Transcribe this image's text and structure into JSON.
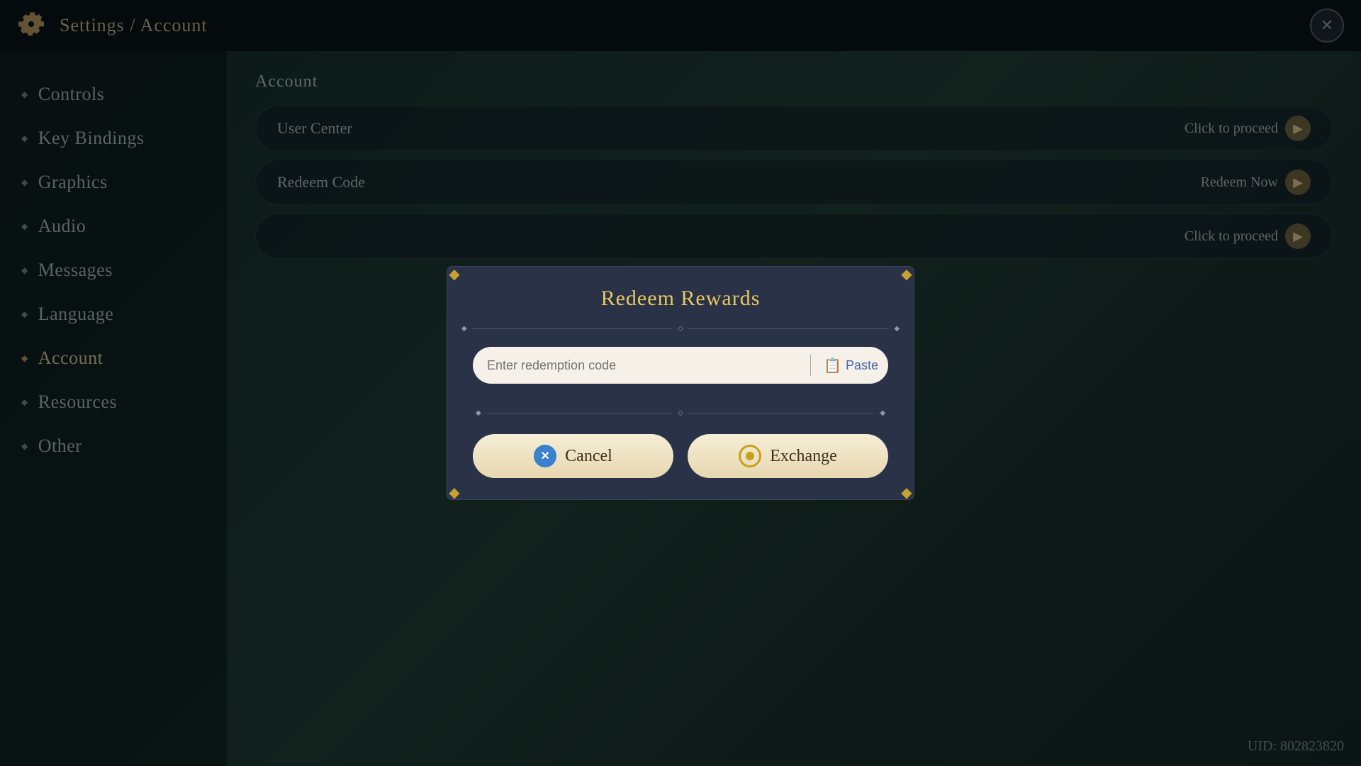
{
  "topbar": {
    "title": "Settings / Account",
    "close_label": "✕"
  },
  "sidebar": {
    "items": [
      {
        "id": "controls",
        "label": "Controls",
        "active": false
      },
      {
        "id": "key-bindings",
        "label": "Key Bindings",
        "active": false
      },
      {
        "id": "graphics",
        "label": "Graphics",
        "active": false
      },
      {
        "id": "audio",
        "label": "Audio",
        "active": false
      },
      {
        "id": "messages",
        "label": "Messages",
        "active": false
      },
      {
        "id": "language",
        "label": "Language",
        "active": false
      },
      {
        "id": "account",
        "label": "Account",
        "active": true
      },
      {
        "id": "resources",
        "label": "Resources",
        "active": false
      },
      {
        "id": "other",
        "label": "Other",
        "active": false
      }
    ]
  },
  "main": {
    "section_title": "Account",
    "rows": [
      {
        "label": "User Center",
        "action": "Click to proceed"
      },
      {
        "label": "Redeem Code",
        "action": "Redeem Now"
      },
      {
        "label": "",
        "action": "Click to proceed"
      }
    ]
  },
  "modal": {
    "title": "Redeem Rewards",
    "input_placeholder": "Enter redemption code",
    "paste_label": "Paste",
    "cancel_label": "Cancel",
    "exchange_label": "Exchange"
  },
  "uid": {
    "label": "UID: 802823820"
  },
  "corners": {
    "symbol": "❖"
  }
}
